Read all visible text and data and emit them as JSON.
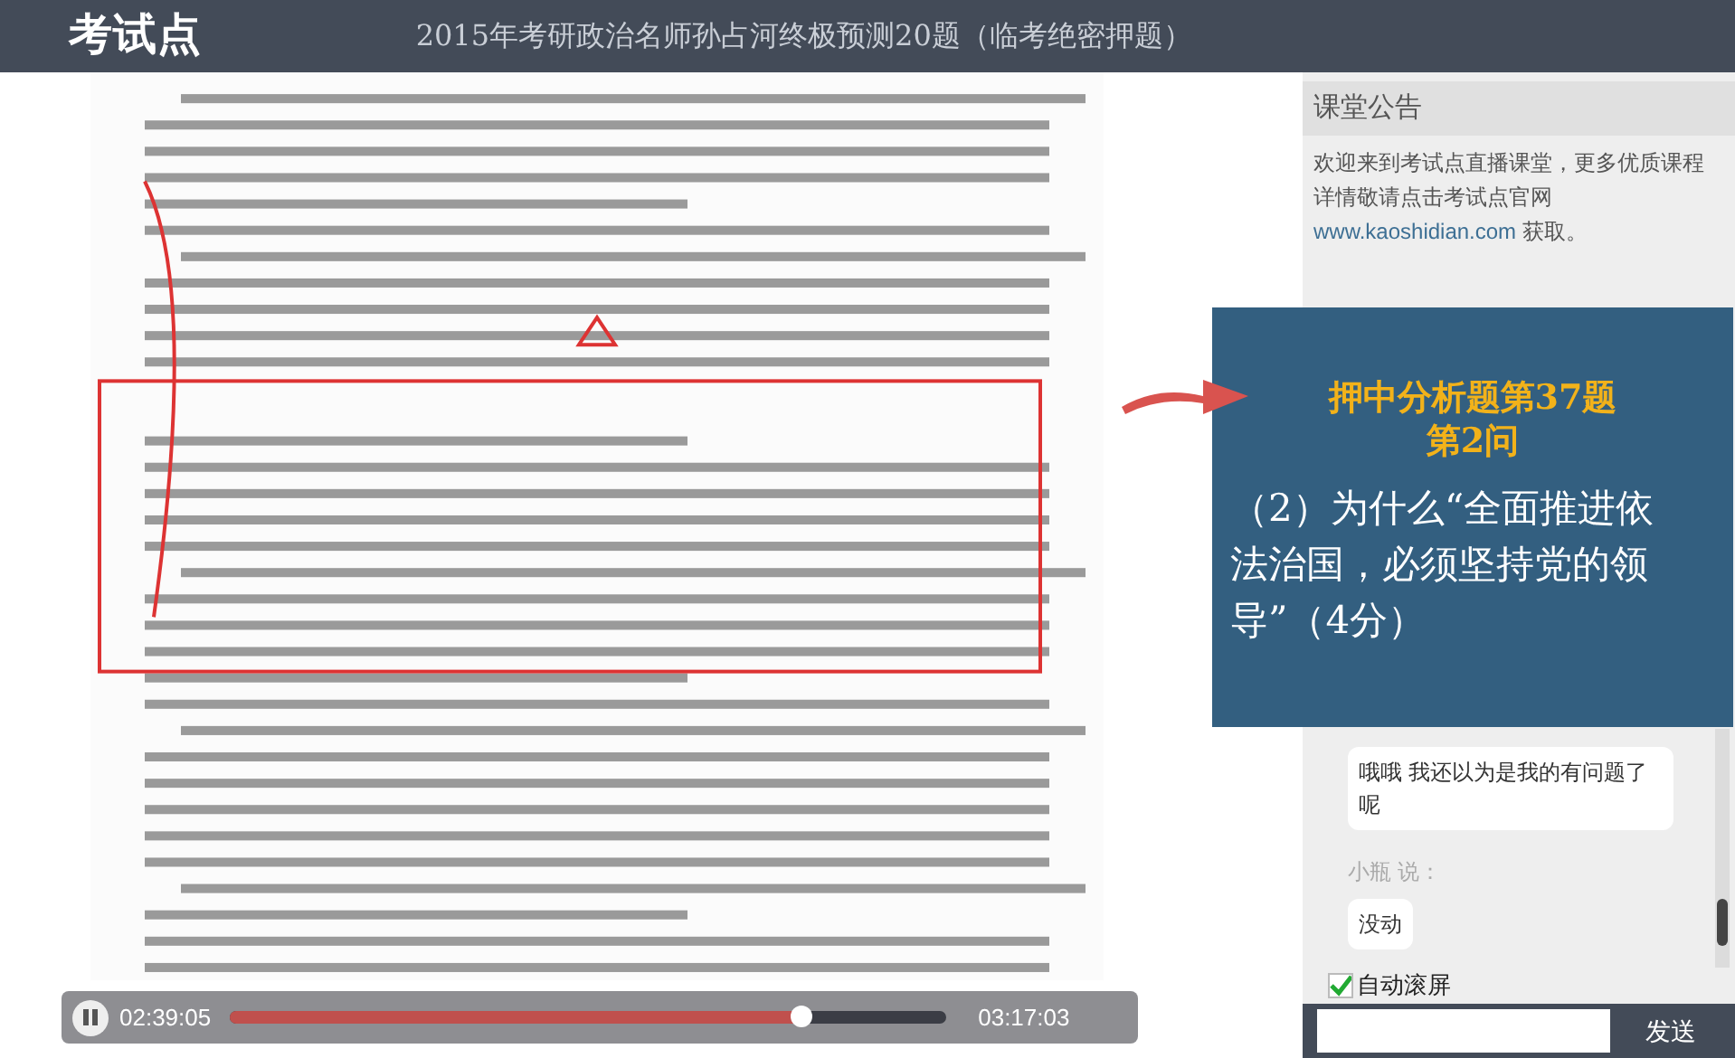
{
  "header": {
    "logo": "考试点",
    "title": "2015年考研政治名师孙占河终极预测20题（临考绝密押题）"
  },
  "video": {
    "player": {
      "playing": true,
      "elapsed": "02:39:05",
      "duration": "03:17:03",
      "level": 0.8
    }
  },
  "notice": {
    "title": "课堂公告",
    "text": "欢迎来到考试点直播课堂，更多优质课程详情敬请点击考试点官网",
    "link": "www.kaoshidian.com",
    "suffix": " 获取。"
  },
  "chat": {
    "messages": [
      {
        "text": "哦哦  我还以为是我的有问题了呢"
      },
      {
        "author": "小瓶 说：",
        "text": "没动"
      }
    ],
    "auto_scroll": {
      "label": "自动滚屏",
      "checked": true
    },
    "send_button": "发送"
  },
  "callout": {
    "headline": [
      "押中分析题第37题",
      "第2问"
    ],
    "question": "（2）为什么“全面推进依法治国，必须坚持党的领导”（4分）"
  }
}
